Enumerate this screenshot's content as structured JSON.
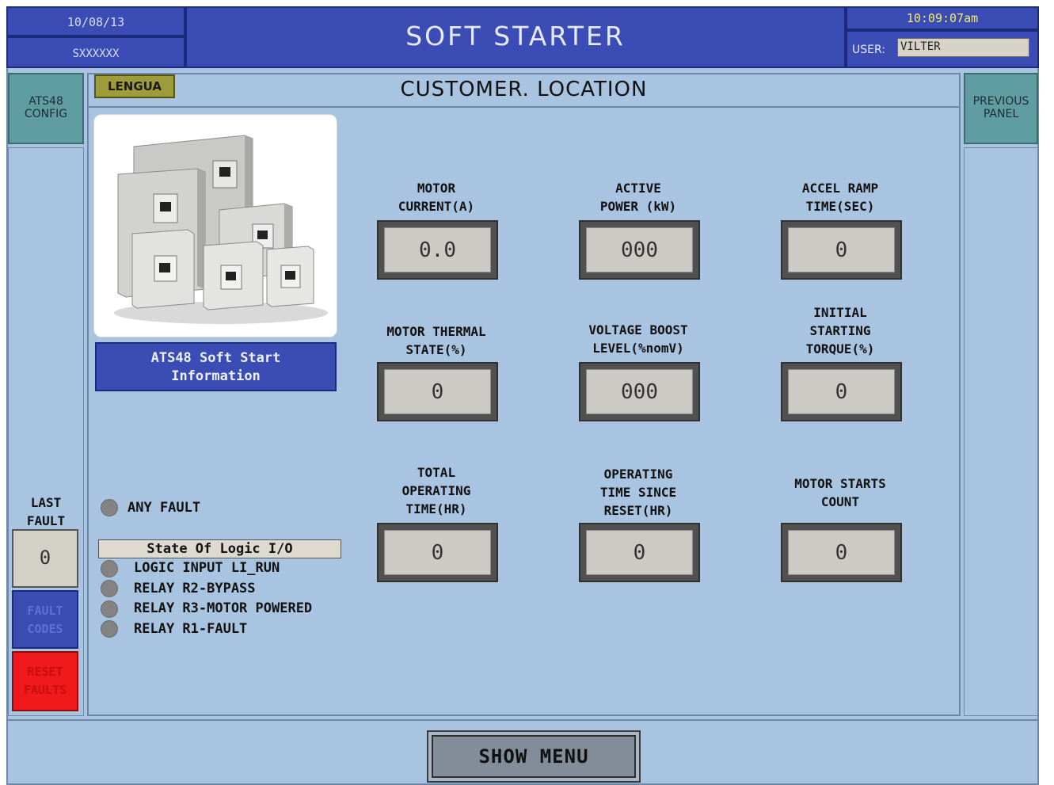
{
  "header": {
    "date": "10/08/13",
    "code": "SXXXXXX",
    "title": "SOFT STARTER",
    "time": "10:09:07am",
    "user_label": "USER:",
    "user_value": "VILTER"
  },
  "nav": {
    "left_top_button": "ATS48\nCONFIG",
    "right_top_button": "PREVIOUS\nPANEL"
  },
  "location": {
    "language_button": "LENGUA",
    "title": "CUSTOMER. LOCATION"
  },
  "info_button": "ATS48 Soft Start\nInformation",
  "fields": [
    {
      "label": "MOTOR\nCURRENT(A)",
      "value": "0.0"
    },
    {
      "label": "ACTIVE\nPOWER (kW)",
      "value": "000"
    },
    {
      "label": "ACCEL RAMP\nTIME(SEC)",
      "value": "0"
    },
    {
      "label": "MOTOR THERMAL\nSTATE(%)",
      "value": "0"
    },
    {
      "label": "VOLTAGE BOOST\nLEVEL(%nomV)",
      "value": "000"
    },
    {
      "label": "INITIAL\nSTARTING\nTORQUE(%)",
      "value": "0"
    },
    {
      "label": "TOTAL\nOPERATING\nTIME(HR)",
      "value": "0"
    },
    {
      "label": "OPERATING\nTIME SINCE\nRESET(HR)",
      "value": "0"
    },
    {
      "label": "MOTOR STARTS\nCOUNT",
      "value": "0"
    }
  ],
  "status": {
    "any_fault": "ANY FAULT",
    "io_header": "State Of Logic I/O",
    "io_items": [
      "LOGIC INPUT LI_RUN",
      "RELAY R2-BYPASS",
      "RELAY R3-MOTOR POWERED",
      "RELAY R1-FAULT"
    ],
    "led_color": "#838383"
  },
  "fault": {
    "last_fault_label": "LAST\nFAULT",
    "last_fault_value": "0",
    "fault_codes_button": "FAULT\nCODES",
    "reset_faults_button": "RESET\nFAULTS"
  },
  "footer": {
    "show_menu": "SHOW MENU"
  },
  "colors": {
    "background": "#a8c4e0",
    "header_blue": "#3b4cb4",
    "teal_button": "#5f9da2",
    "reset_red": "#f0191b",
    "time_yellow": "#f1ef6a"
  }
}
